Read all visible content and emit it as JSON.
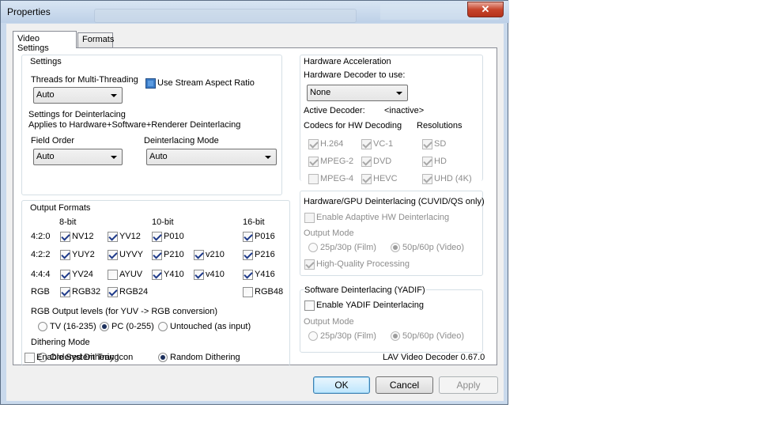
{
  "window": {
    "title": "Properties",
    "close_glyph": "✕"
  },
  "tabs": [
    {
      "label": "Video Settings"
    },
    {
      "label": "Formats"
    }
  ],
  "settings": {
    "group_title": "Settings",
    "threads_label": "Threads for Multi-Threading",
    "threads_value": "Auto",
    "stream_aspect_label": "Use Stream Aspect Ratio",
    "deint_title": "Settings for Deinterlacing",
    "deint_sub": "Applies to Hardware+Software+Renderer Deinterlacing",
    "field_order_label": "Field Order",
    "field_order_value": "Auto",
    "deint_mode_label": "Deinterlacing Mode",
    "deint_mode_value": "Auto"
  },
  "output": {
    "group_title": "Output Formats",
    "col_8bit": "8-bit",
    "col_10bit": "10-bit",
    "col_16bit": "16-bit",
    "row_420": "4:2:0",
    "row_422": "4:2:2",
    "row_444": "4:4:4",
    "row_rgb": "RGB",
    "nv12": "NV12",
    "yv12": "YV12",
    "p010": "P010",
    "p016": "P016",
    "yuy2": "YUY2",
    "uyvy": "UYVY",
    "p210": "P210",
    "v210": "v210",
    "p216": "P216",
    "yv24": "YV24",
    "ayuv": "AYUV",
    "y410": "Y410",
    "v410": "v410",
    "y416": "Y416",
    "rgb32": "RGB32",
    "rgb24": "RGB24",
    "rgb48": "RGB48",
    "levels_label": "RGB Output levels (for YUV -> RGB conversion)",
    "tv": "TV (16-235)",
    "pc": "PC (0-255)",
    "untouched": "Untouched (as input)",
    "dither_label": "Dithering Mode",
    "ordered": "Ordered Dithering",
    "random": "Random Dithering"
  },
  "hw": {
    "group_title": "Hardware Acceleration",
    "decoder_label": "Hardware Decoder to use:",
    "decoder_value": "None",
    "active_label": "Active Decoder:",
    "active_value": "<inactive>",
    "codecs_label": "Codecs for HW Decoding",
    "res_label": "Resolutions",
    "h264": "H.264",
    "vc1": "VC-1",
    "sd": "SD",
    "mpeg2": "MPEG-2",
    "dvd": "DVD",
    "hd": "HD",
    "mpeg4": "MPEG-4",
    "hevc": "HEVC",
    "uhd": "UHD (4K)"
  },
  "gpu_deint": {
    "group_title": "Hardware/GPU Deinterlacing (CUVID/QS only)",
    "adaptive": "Enable Adaptive HW Deinterlacing",
    "output_mode": "Output Mode",
    "film": "25p/30p (Film)",
    "video": "50p/60p (Video)",
    "hq": "High-Quality Processing"
  },
  "yadif": {
    "group_title": "Software Deinterlacing (YADIF)",
    "enable": "Enable YADIF Deinterlacing",
    "output_mode": "Output Mode",
    "film": "25p/30p (Film)",
    "video": "50p/60p (Video)"
  },
  "footer": {
    "tray": "Enable System Tray Icon",
    "version": "LAV Video Decoder 0.67.0",
    "ok": "OK",
    "cancel": "Cancel",
    "apply": "Apply"
  }
}
